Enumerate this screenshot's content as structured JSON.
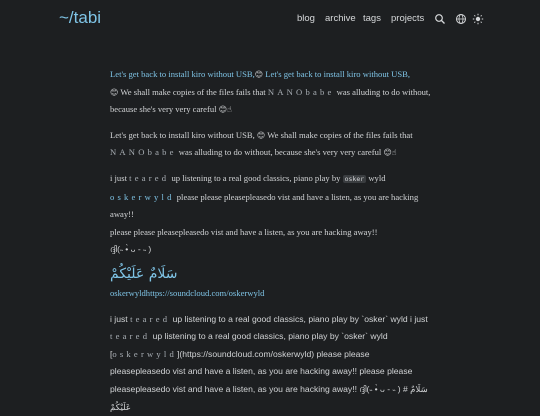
{
  "header": {
    "logo": "~/tabi",
    "nav": [
      "blog",
      "archive",
      "tags",
      "projects"
    ],
    "icons": [
      "search-icon",
      "globe-icon",
      "theme-toggle-icon"
    ]
  },
  "p1": {
    "link_a": "Let's get back to install kiro without USB,",
    "emoji_a": "😊",
    "link_b": " Let's get back to install kiro without USB,",
    "emoji_b": "😊",
    "t1": " We shall make copies of the files fails that ",
    "spaced": "NANObabe",
    "t2": " was alluding to do without, because she's very very careful ",
    "emoji_c": "😊☝"
  },
  "p2": {
    "t1": "Let's get back to install kiro without USB, ",
    "emoji_a": "😊",
    "t2": " We shall make copies of the files fails that ",
    "spaced": "NANObabe",
    "t3": " was alluding to do without, because she's very very careful ",
    "emoji_b": "😊☝"
  },
  "p3": {
    "t1": "i just ",
    "spaced_a": "teared",
    "t2": " up listening to a real good classics, piano play by ",
    "code": "osker",
    "t3": " wyld ",
    "spaced_link": "oskerwyld",
    "t4": " please please pleasepleasedo vist and have a listen, as you are hacking away!!",
    "line2": "please please pleasepleasedo vist and have a listen, as you are hacking away!!",
    "kaomoji": "ദ്ദി(˵ •̀ ᴗ - ˵ )"
  },
  "arabic": "سَلَامٌ عَلَيْكُمْ",
  "link_line": "oskerwyldhttps://soundcloud.com/oskerwyld",
  "p4": {
    "t1": "i just ",
    "spaced_a": "teared",
    "t2": " up listening to a real good classics, piano play by `osker` wyld i just ",
    "spaced_b": "teared",
    "t3": " up listening to a real good classics, piano play by `osker` wyld [",
    "spaced_c": "oskerwyld",
    "t4": "](https://soundcloud.com/oskerwyld) please please pleasepleasedo vist and have a listen, as you are hacking away!! please please pleasepleasedo vist and have a listen, as you are hacking away!! ",
    "tail": "ദ്ദി(˵ •̀ ᴗ - ˵ ) # سَلَامٌ عَلَيْكُمْ"
  }
}
